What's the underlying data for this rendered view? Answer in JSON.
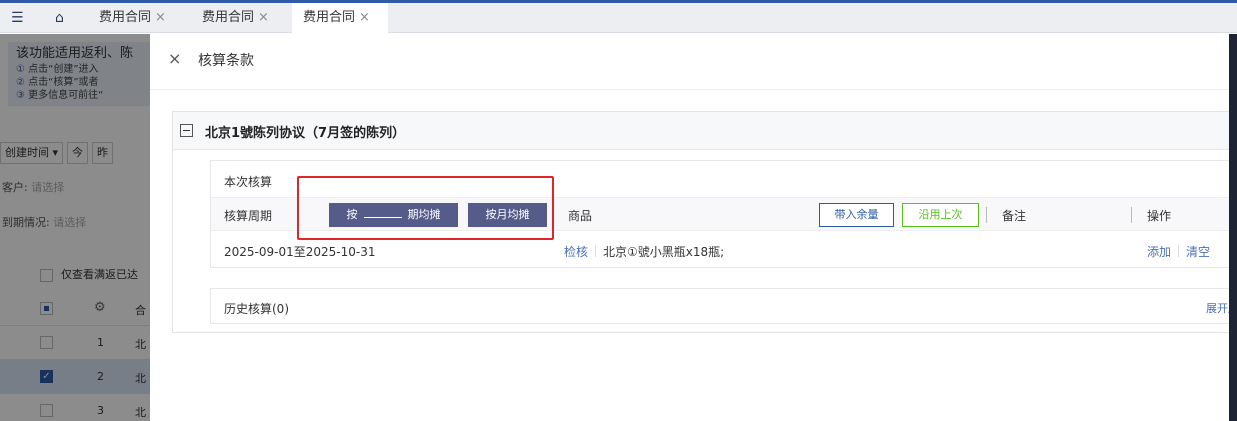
{
  "tabs": [
    {
      "label": "费用合同",
      "active": false
    },
    {
      "label": "费用合同",
      "active": false
    },
    {
      "label": "费用合同",
      "active": true
    }
  ],
  "tab_close": "×",
  "background": {
    "notice_title": "该功能适用返利、陈",
    "notice_lines": [
      {
        "num": "①",
        "text": "点击“创建”进入"
      },
      {
        "num": "②",
        "text": "点击“核算”或者"
      },
      {
        "num": "③",
        "text": "更多信息可前往“"
      }
    ],
    "filter_created_time": "创建时间",
    "filter_today": "今",
    "filter_yesterday": "昨",
    "customer_label": "客户:",
    "customer_placeholder": "请选择",
    "expiry_label": "到期情况:",
    "expiry_placeholder": "请选择",
    "only_show_label": "仅查看满返已达",
    "table_header_cell": "合",
    "rows": [
      {
        "num": "1",
        "cell": "北",
        "checked": false
      },
      {
        "num": "2",
        "cell": "北",
        "checked": true
      },
      {
        "num": "3",
        "cell": "北",
        "checked": false
      }
    ]
  },
  "drawer": {
    "close_icon": "×",
    "title": "核算条款",
    "card": {
      "title": "北京1號陈列协议（7月签的陈列）",
      "current_section_title": "本次核算",
      "header": {
        "period": "核算周期",
        "btn_by_period_prefix": "按",
        "btn_by_period_suffix": "期均摊",
        "btn_by_month": "按月均摊",
        "goods": "商品",
        "btn_bring_remaining": "带入余量",
        "btn_use_last": "沿用上次",
        "remark": "备注",
        "operation": "操作"
      },
      "row": {
        "period": "2025-09-01至2025-10-31",
        "check_link": "检核",
        "goods": "北京①號小黑瓶x18瓶;",
        "add_link": "添加",
        "clear_link": "清空"
      },
      "history_title": "历史核算(0)",
      "expand_link": "展开历"
    }
  },
  "colors": {
    "primary": "#2e5aa8",
    "dark_button": "#555c8a",
    "link": "#4a6fb8",
    "green": "#52c41a",
    "highlight": "#e0262a"
  }
}
